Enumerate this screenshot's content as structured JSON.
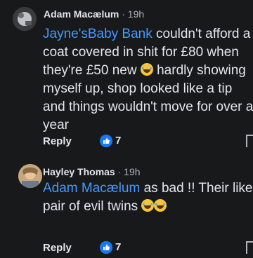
{
  "comments": [
    {
      "author": "Adam Macælum",
      "time": "· 19h",
      "mention": "Jayne'sBaby Bank",
      "lines": [
        " couldn't afford a",
        "coat covered in shit for £80 when",
        "they're £50 new ",
        " hardly showing",
        "myself up, shop looked like a tip",
        "and things wouldn't move for over a",
        "year"
      ],
      "reply_label": "Reply",
      "like_count": "7"
    },
    {
      "author": "Hayley Thomas",
      "time": "· 19h",
      "mention": "Adam Macælum",
      "lines": [
        " as bad !! Their like a",
        "pair of evil twins "
      ],
      "reply_label": "Reply",
      "like_count": "7"
    }
  ],
  "icons": {
    "reaction": "laughing-emoji-icon",
    "like": "thumbs-up-icon"
  },
  "colors": {
    "background": "#18191a",
    "mention": "#4599ff",
    "like_badge": "#1877f2"
  }
}
